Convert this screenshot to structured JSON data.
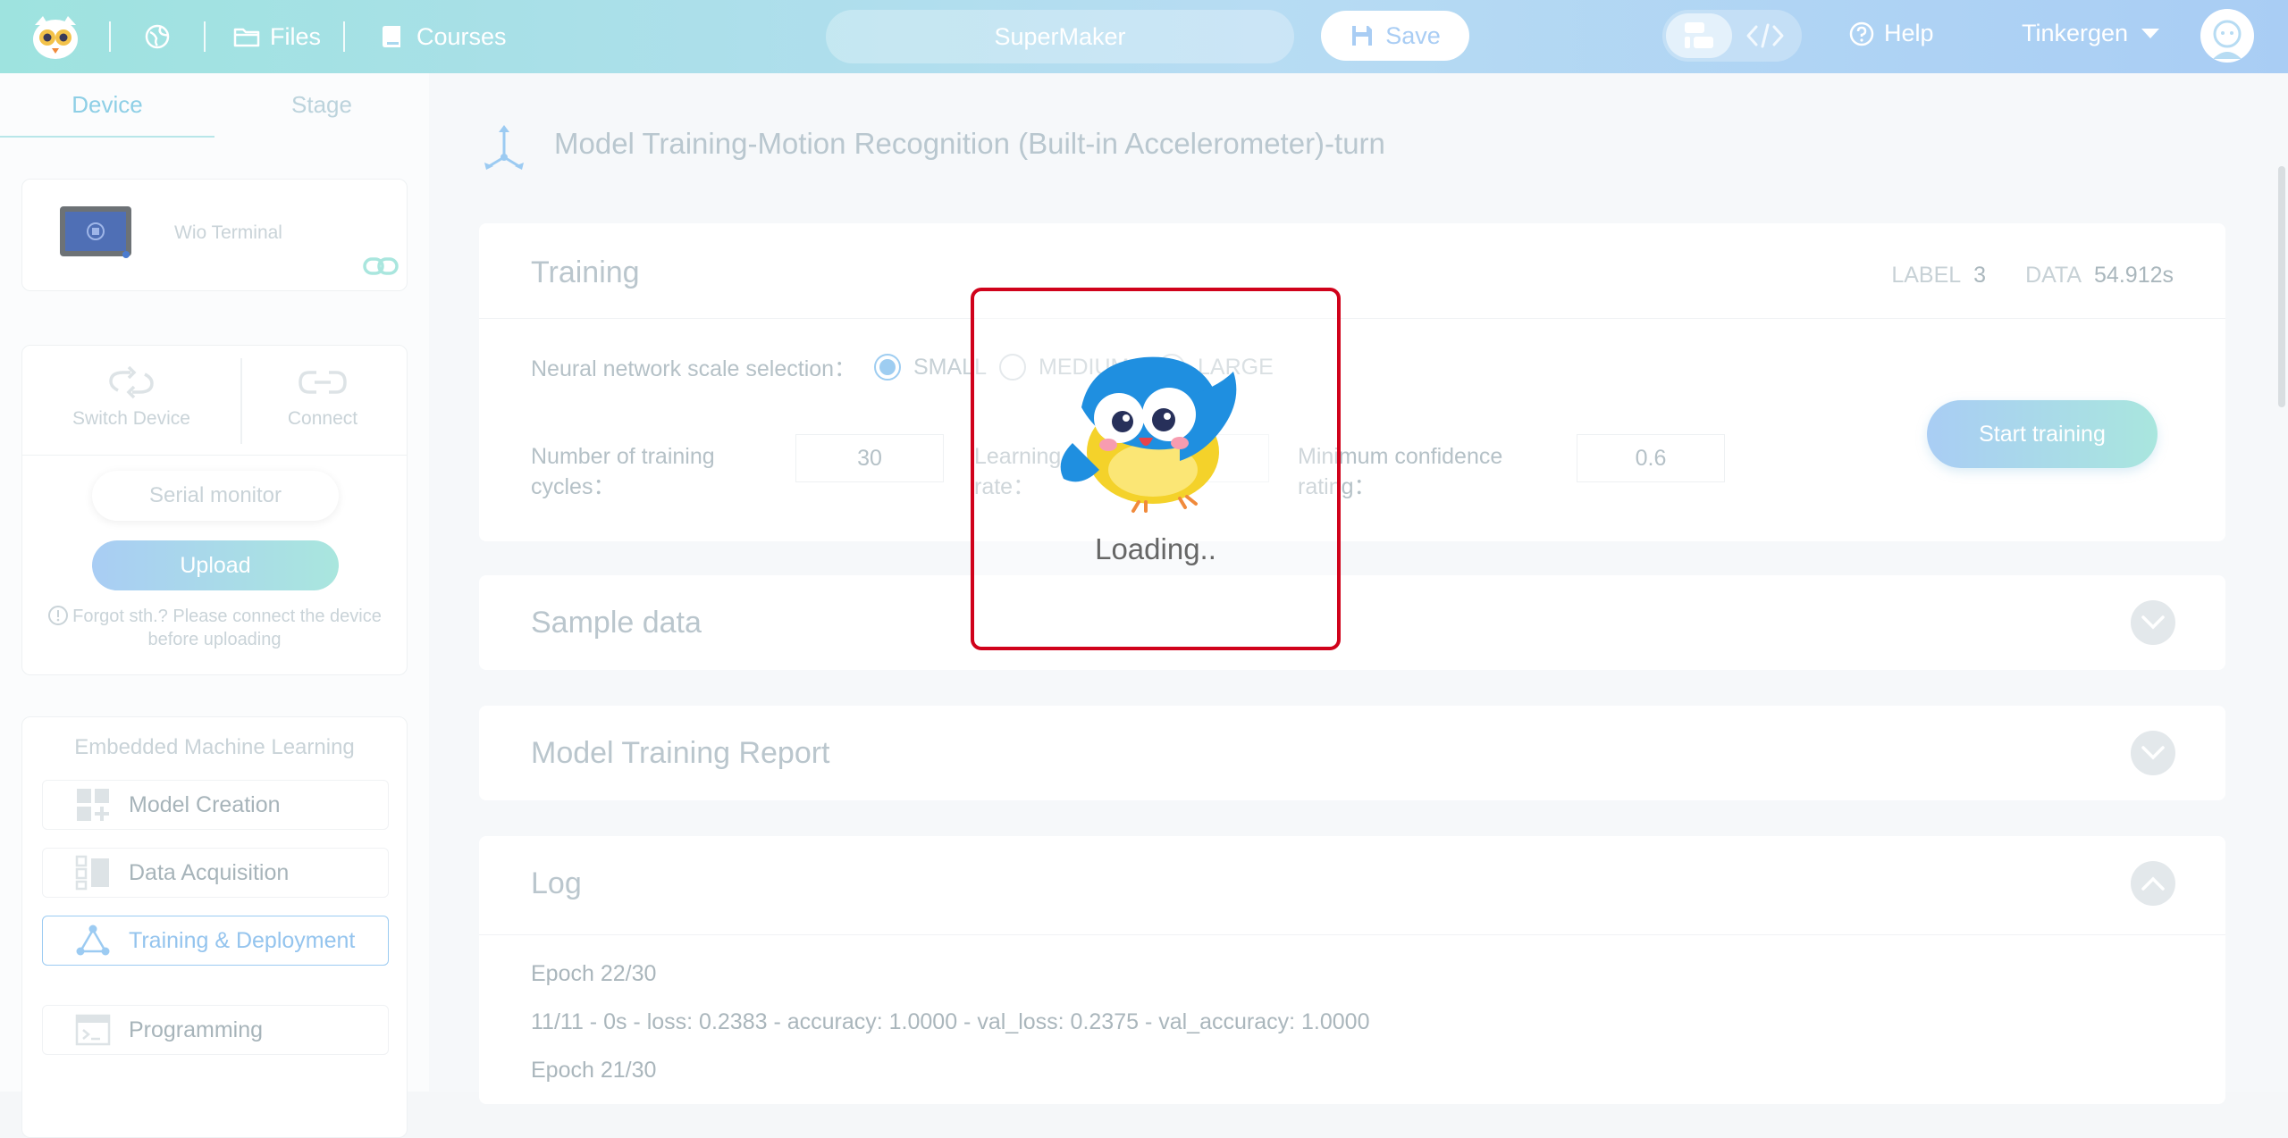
{
  "topbar": {
    "files_label": "Files",
    "courses_label": "Courses",
    "project_name": "SuperMaker",
    "save_label": "Save",
    "help_label": "Help",
    "user_name": "Tinkergen"
  },
  "sidebar": {
    "tabs": [
      "Device",
      "Stage"
    ],
    "device_name": "Wio Terminal",
    "switch_device": "Switch Device",
    "connect": "Connect",
    "serial_monitor": "Serial monitor",
    "upload": "Upload",
    "forgot_line1": "Forgot sth.? Please connect the device",
    "forgot_line2": "before uploading",
    "eml_title": "Embedded Machine Learning",
    "menu": [
      "Model Creation",
      "Data Acquisition",
      "Training & Deployment",
      "Programming"
    ]
  },
  "main": {
    "page_title": "Model Training-Motion Recognition (Built-in Accelerometer)-turn",
    "training": {
      "title": "Training",
      "label_key": "LABEL",
      "label_value": "3",
      "data_key": "DATA",
      "data_value": "54.912s",
      "nn_scale_label": "Neural network scale selection：",
      "options": [
        "SMALL",
        "MEDIUM",
        "LARGE"
      ],
      "cycles_label_1": "Number of training",
      "cycles_label_2": "cycles：",
      "cycles_value": "30",
      "lr_label_1": "Learning",
      "lr_label_2": "rate：",
      "conf_label_1": "Minimum confidence",
      "conf_label_2": "rating：",
      "conf_value": "0.6",
      "start_label": "Start training"
    },
    "sample_data_title": "Sample data",
    "report_title": "Model Training Report",
    "log_title": "Log",
    "log_lines": [
      "Epoch 22/30",
      "11/11 - 0s - loss: 0.2383 - accuracy: 1.0000 - val_loss: 0.2375 - val_accuracy: 1.0000",
      "Epoch 21/30"
    ]
  },
  "loading": {
    "text": "Loading.."
  }
}
